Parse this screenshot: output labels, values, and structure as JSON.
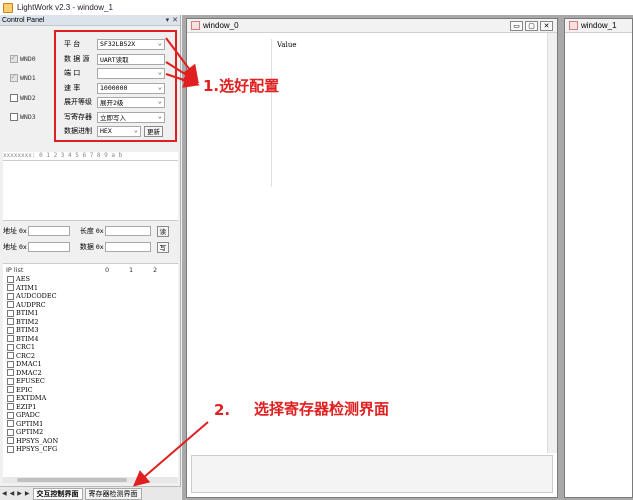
{
  "window": {
    "title": "LightWork v2.3 - window_1"
  },
  "panel": {
    "title": "Control Panel",
    "pin": "▾",
    "close": "✕",
    "wnd_checks": [
      {
        "label": "WND0",
        "checked": true
      },
      {
        "label": "WND1",
        "checked": true
      },
      {
        "label": "WND2",
        "checked": false
      },
      {
        "label": "WND3",
        "checked": false
      }
    ],
    "config": {
      "platform_label": "平  台",
      "platform_value": "SF32LB52X",
      "source_label": "数 据 源",
      "source_value": "UART读取",
      "port_label": "端  口",
      "port_value": "",
      "baud_label": "速  率",
      "baud_value": "1000000",
      "expand_label": "展开等级",
      "expand_value": "展开2级",
      "write_label": "写寄存器",
      "write_value": "立即写入",
      "radix_label": "数据进制",
      "radix_value": "HEX",
      "update_button": "更新"
    },
    "hex_header": "xxxxxxxx: 0  1  2  3  4  5  6  7  8  9  a  b",
    "addr_rows": [
      {
        "addr_label": "地址",
        "addr_prefix": "0x",
        "len_label": "长度",
        "len_prefix": "0x",
        "button": "读"
      },
      {
        "addr_label": "地址",
        "addr_prefix": "0x",
        "len_label": "数据",
        "len_prefix": "0x",
        "button": "写"
      }
    ],
    "ip_list": {
      "header": "IP list",
      "cols": [
        "0",
        "1",
        "2"
      ],
      "items": [
        "AES",
        "ATIM1",
        "AUDCODEC",
        "AUDPRC",
        "BTIM1",
        "BTIM2",
        "BTIM3",
        "BTIM4",
        "CRC1",
        "CRC2",
        "DMAC1",
        "DMAC2",
        "EFUSEC",
        "EPIC",
        "EXTDMA",
        "EZIP1",
        "GPADC",
        "GPTIM1",
        "GPTIM2",
        "HPSYS_AON",
        "HPSYS_CFG"
      ]
    },
    "tabs": {
      "nav": [
        "◀",
        "◀",
        "▶",
        "▶"
      ],
      "items": [
        {
          "label": "交互控制界面",
          "active": true
        },
        {
          "label": "寄存器检测界面",
          "active": false
        }
      ]
    }
  },
  "mdi": {
    "window0": {
      "title": "window_0",
      "column": "Value",
      "min": "▭",
      "max": "▢",
      "close": "✕"
    },
    "window1": {
      "title": "window_1"
    }
  },
  "annotations": {
    "step1": "1.选好配置",
    "step2_num": "2.",
    "step2_text": "选择寄存器检测界面",
    "color": "#e02020"
  }
}
